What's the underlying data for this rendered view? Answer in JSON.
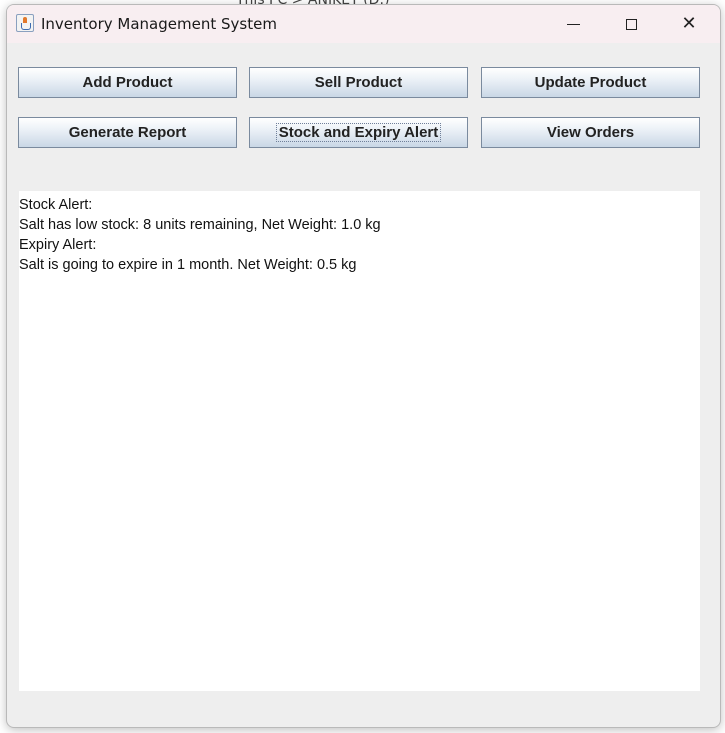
{
  "window": {
    "title": "Inventory Management System",
    "controls": {
      "minimize": "─",
      "maximize": "☐",
      "close": "✕"
    }
  },
  "buttons": {
    "add_product": "Add Product",
    "sell_product": "Sell Product",
    "update_product": "Update Product",
    "generate_report": "Generate Report",
    "stock_expiry_alert": "Stock and Expiry Alert",
    "view_orders": "View Orders"
  },
  "output": {
    "lines": [
      "Stock Alert:",
      "Salt has low stock: 8 units remaining, Net Weight: 1.0 kg",
      "Expiry Alert:",
      "Salt is going to expire in 1 month. Net Weight: 0.5 kg"
    ]
  },
  "background": {
    "top_text": "This PC  >  ANIKET (D:)"
  },
  "colors": {
    "titlebar": "#f8eef1",
    "window_body": "#eeeeee",
    "button_border": "#7a8a9e",
    "textarea": "#ffffff"
  }
}
